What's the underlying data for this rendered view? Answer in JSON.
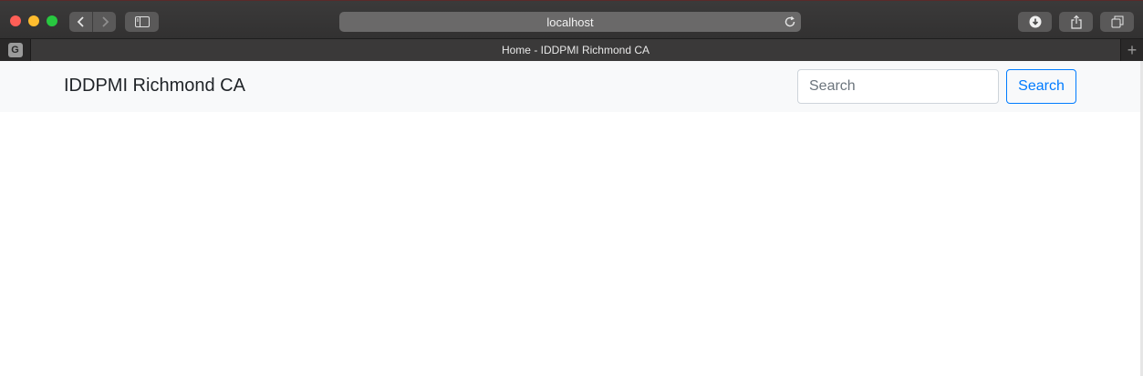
{
  "browser": {
    "address": "localhost",
    "pinned_tab_letter": "G",
    "active_tab_title": "Home - IDDPMI Richmond CA",
    "new_tab_symbol": "+"
  },
  "icons": {
    "back": "chevron-left-icon",
    "forward": "chevron-right-icon",
    "sidebar": "sidebar-icon",
    "reload": "reload-icon",
    "download": "download-icon",
    "share": "share-icon",
    "tabs": "tabs-overview-icon"
  },
  "navbar": {
    "brand": "IDDPMI Richmond CA",
    "search_placeholder": "Search",
    "search_button": "Search"
  },
  "colors": {
    "accent": "#007bff",
    "navbar_bg": "#f8f9fa"
  }
}
